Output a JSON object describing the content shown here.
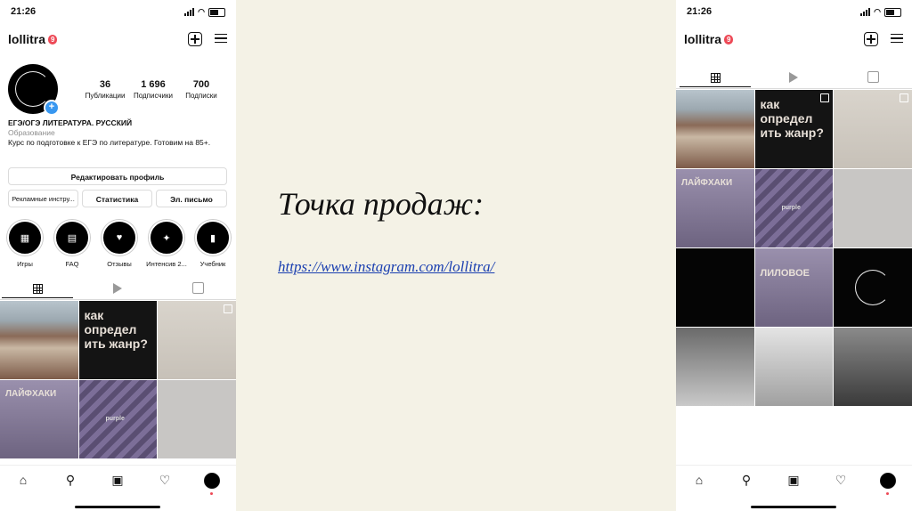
{
  "slide": {
    "title": "Точка продаж:",
    "link": "https://www.instagram.com/lollitra/"
  },
  "status": {
    "time": "21:26"
  },
  "profile": {
    "username": "lollitra",
    "notif_count": "9",
    "stats": [
      {
        "num": "36",
        "label": "Публикации"
      },
      {
        "num": "1 696",
        "label": "Подписчики"
      },
      {
        "num": "700",
        "label": "Подписки"
      }
    ],
    "bio_title": "ЕГЭ/ОГЭ ЛИТЕРАТУРА. РУССКИЙ",
    "bio_category": "Образование",
    "bio_text": "Курс по подготовке к ЕГЭ по литературе. Готовим на 85+.",
    "edit_button": "Редактировать профиль",
    "ads_button": "Рекламные инстру...",
    "stats_button": "Статистика",
    "email_button": "Эл. письмо"
  },
  "highlights": [
    {
      "label": "Игры",
      "icon": "puzzle-icon"
    },
    {
      "label": "FAQ",
      "icon": "faq-icon"
    },
    {
      "label": "Отзывы",
      "icon": "chat-heart-icon"
    },
    {
      "label": "Интенсив 2...",
      "icon": "runner-icon"
    },
    {
      "label": "Учебник",
      "icon": "book-icon"
    }
  ],
  "posts": {
    "left_text_1": "как определ ить жанр?",
    "left_text_2": "ЛАЙФХАКИ",
    "right_text_1": "как определ ить жанр?",
    "right_text_2": "ЛАЙФХАКИ",
    "purple_label": "purple",
    "lilac_text": "ЛИЛОВОЕ"
  },
  "colors": {
    "accent": "#3897f0",
    "badge": "#ed4956",
    "link": "#1a3fb0"
  }
}
